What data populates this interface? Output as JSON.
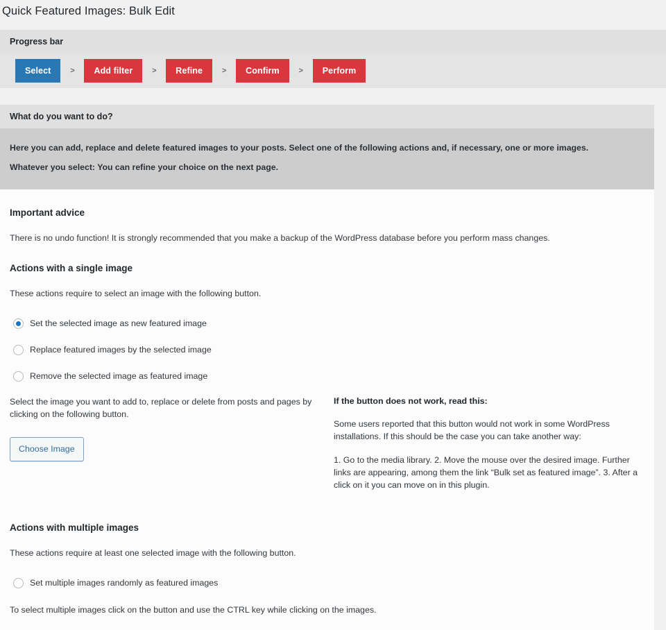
{
  "page": {
    "title": "Quick Featured Images: Bulk Edit"
  },
  "progress": {
    "heading": "Progress bar",
    "separator": ">",
    "steps": [
      {
        "label": "Select",
        "state": "current",
        "color": "#2878b5"
      },
      {
        "label": "Add filter",
        "state": "upcoming",
        "color": "#d9363e"
      },
      {
        "label": "Refine",
        "state": "upcoming",
        "color": "#d9363e"
      },
      {
        "label": "Confirm",
        "state": "upcoming",
        "color": "#d9363e"
      },
      {
        "label": "Perform",
        "state": "upcoming",
        "color": "#d9363e"
      }
    ]
  },
  "main": {
    "heading": "What do you want to do?",
    "intro": [
      "Here you can add, replace and delete featured images to your posts. Select one of the following actions and, if necessary, one or more images.",
      "Whatever you select: You can refine your choice on the next page."
    ],
    "advice": {
      "heading": "Important advice",
      "text": "There is no undo function! It is strongly recommended that you make a backup of the WordPress database before you perform mass changes."
    },
    "single": {
      "heading": "Actions with a single image",
      "intro": "These actions require to select an image with the following button.",
      "options": [
        {
          "label": "Set the selected image as new featured image",
          "checked": true
        },
        {
          "label": "Replace featured images by the selected image",
          "checked": false
        },
        {
          "label": "Remove the selected image as featured image",
          "checked": false
        }
      ],
      "hint": "Select the image you want to add to, replace or delete from posts and pages by clicking on the following button.",
      "button_label": "Choose Image",
      "side": {
        "heading": "If the button does not work, read this:",
        "paragraph1": "Some users reported that this button would not work in some WordPress installations. If this should be the case you can take another way:",
        "paragraph2": "1. Go to the media library. 2. Move the mouse over the desired image. Further links are appearing, among them the link “Bulk set as featured image”. 3. After a click on it you can move on in this plugin."
      }
    },
    "multiple": {
      "heading": "Actions with multiple images",
      "intro": "These actions require at least one selected image with the following button.",
      "options": [
        {
          "label": "Set multiple images randomly as featured images",
          "checked": false
        }
      ],
      "hint": "To select multiple images click on the button and use the CTRL key while clicking on the images."
    }
  },
  "colors": {
    "current_step": "#2878b5",
    "upcoming_step": "#d9363e",
    "panel_header": "#e0e0e0",
    "intro_band": "#cdcdcd",
    "page_background": "#f1f1f1",
    "link_blue": "#2e6ca6"
  }
}
